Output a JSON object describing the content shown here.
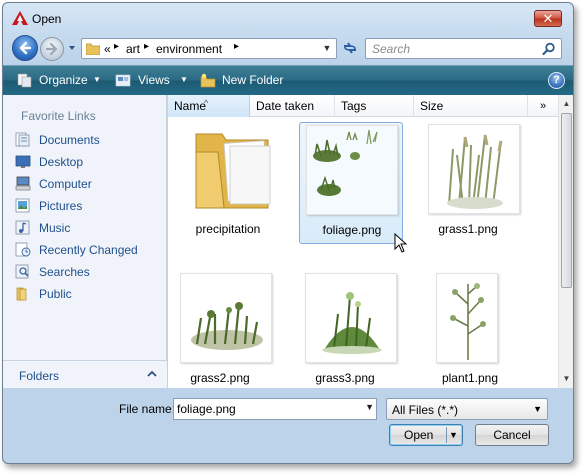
{
  "window": {
    "title": "Open",
    "close_glyph": "✕",
    "app_icon": "autocad-logo-icon"
  },
  "address": {
    "prefix": "«",
    "crumbs": [
      "art",
      "environment"
    ],
    "separator": "▸"
  },
  "search": {
    "placeholder": "Search"
  },
  "toolbar": {
    "organize": "Organize",
    "views": "Views",
    "new_folder": "New Folder",
    "help": "?"
  },
  "favorites": {
    "title": "Favorite Links",
    "items": [
      {
        "label": "Documents",
        "icon": "documents-icon"
      },
      {
        "label": "Desktop",
        "icon": "desktop-icon"
      },
      {
        "label": "Computer",
        "icon": "computer-icon"
      },
      {
        "label": "Pictures",
        "icon": "pictures-icon"
      },
      {
        "label": "Music",
        "icon": "music-icon"
      },
      {
        "label": "Recently Changed",
        "icon": "recently-changed-icon"
      },
      {
        "label": "Searches",
        "icon": "searches-icon"
      },
      {
        "label": "Public",
        "icon": "public-folder-icon"
      }
    ],
    "folders_label": "Folders"
  },
  "columns": [
    {
      "label": "Name",
      "sorted": true
    },
    {
      "label": "Date taken"
    },
    {
      "label": "Tags"
    },
    {
      "label": "Size"
    }
  ],
  "columns_more": "»",
  "files": [
    {
      "name": "precipitation",
      "type": "folder",
      "selected": false
    },
    {
      "name": "foliage.png",
      "type": "image",
      "selected": true
    },
    {
      "name": "grass1.png",
      "type": "image",
      "selected": false
    },
    {
      "name": "grass2.png",
      "type": "image",
      "selected": false
    },
    {
      "name": "grass3.png",
      "type": "image",
      "selected": false
    },
    {
      "name": "plant1.png",
      "type": "image",
      "selected": false
    }
  ],
  "bottom": {
    "file_name_label": "File name:",
    "file_name_value": "foliage.png",
    "filter_value": "All Files (*.*)",
    "open_label": "Open",
    "cancel_label": "Cancel"
  },
  "colors": {
    "toolbar": "#2a6a84",
    "link_text": "#1f4f8c",
    "selection": "#d8ebfa"
  }
}
